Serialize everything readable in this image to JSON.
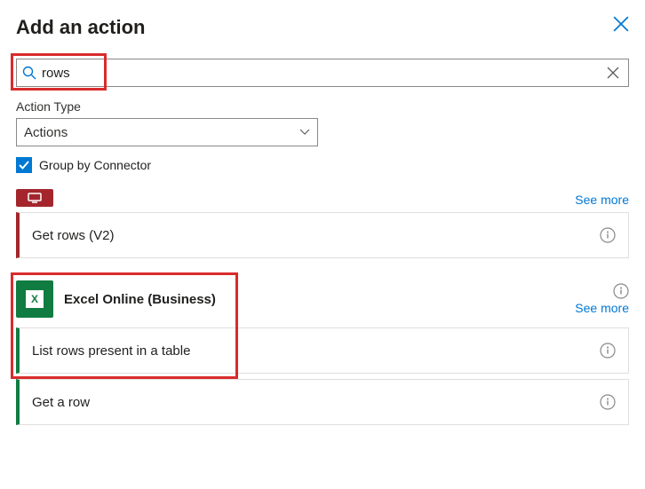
{
  "header": {
    "title": "Add an action"
  },
  "search": {
    "value": "rows"
  },
  "actionType": {
    "label": "Action Type",
    "selected": "Actions"
  },
  "groupBy": {
    "checked": true,
    "label": "Group by Connector"
  },
  "group1": {
    "seeMore": "See more",
    "leftColor": "#a4262c",
    "actions": [
      {
        "label": "Get rows (V2)"
      }
    ]
  },
  "group2": {
    "connectorName": "Excel Online (Business)",
    "seeMore": "See more",
    "leftColor": "#107c41",
    "actions": [
      {
        "label": "List rows present in a table"
      },
      {
        "label": "Get a row"
      }
    ]
  }
}
